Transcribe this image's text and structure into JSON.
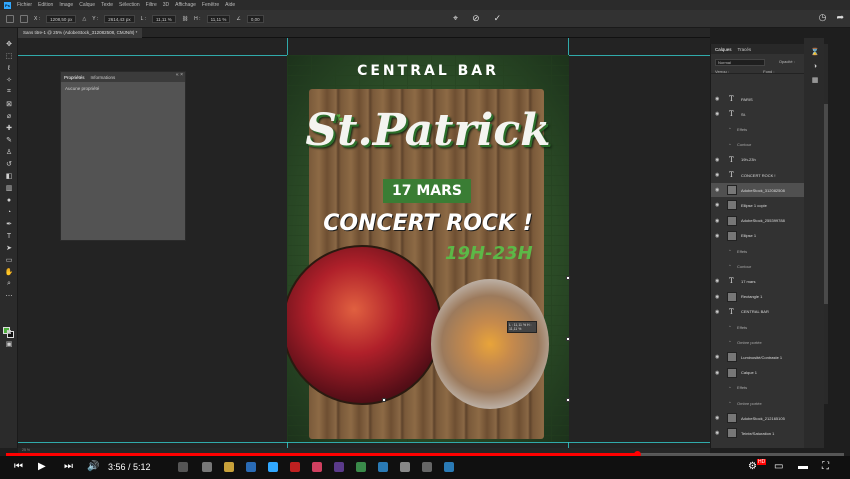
{
  "menu": [
    "Fichier",
    "Edition",
    "Image",
    "Calque",
    "Texte",
    "Sélection",
    "Filtre",
    "3D",
    "Affichage",
    "Fenêtre",
    "Aide"
  ],
  "app_logo": "Ps",
  "options": {
    "x_value": "1208,50 px",
    "y_value": "2614,43 px",
    "w_value": "11,11 %",
    "h_value": "11,11 %",
    "angle_value": "0,00"
  },
  "doc_tab": "Sans titre-1 @ 25% (AdobeStock_312082508, CMJN/8) *",
  "properties": {
    "tab_active": "Propriétés",
    "tab_other": "Informations",
    "body": "Aucune propriété"
  },
  "poster": {
    "header": "CENTRAL BAR",
    "title": "St.Patrick",
    "date": "17 MARS",
    "headline": "CONCERT ROCK !",
    "hours": "19H-23H"
  },
  "layers_panel": {
    "tab_active": "Calques",
    "tab_other": "Tracés",
    "blend_mode": "Normal",
    "opacity_label": "Opacité :",
    "opacity_value": "100 %",
    "fill_label": "Fond :",
    "fill_value": "100 %",
    "lock_label": "Verrou :"
  },
  "layers": [
    {
      "type": "text",
      "label": "PARIS",
      "fx": true
    },
    {
      "type": "text",
      "label": "St.",
      "fx": true
    },
    {
      "type": "sub",
      "label": "Effets"
    },
    {
      "type": "sub",
      "label": "Contour"
    },
    {
      "type": "text",
      "label": "19h-23h",
      "fx": true
    },
    {
      "type": "text",
      "label": "CONCERT ROCK !",
      "fx": false
    },
    {
      "type": "image",
      "label": "AdobeStock_312082508",
      "fx": false,
      "selected": true
    },
    {
      "type": "image",
      "label": "Ellipse 1 copie",
      "fx": false
    },
    {
      "type": "image",
      "label": "AdobeStock_255399788",
      "fx": false
    },
    {
      "type": "image",
      "label": "Ellipse 1",
      "fx": true
    },
    {
      "type": "sub",
      "label": "Effets"
    },
    {
      "type": "sub",
      "label": "Contour"
    },
    {
      "type": "text",
      "label": "17 mars",
      "fx": true
    },
    {
      "type": "image",
      "label": "Rectangle 1",
      "fx": false
    },
    {
      "type": "text",
      "label": "CENTRAL BAR",
      "fx": false
    },
    {
      "type": "sub",
      "label": "Effets"
    },
    {
      "type": "sub",
      "label": "Ombre portée"
    },
    {
      "type": "image",
      "label": "Luminosité/Contraste 1",
      "fx": false
    },
    {
      "type": "image",
      "label": "Calque 1",
      "fx": true
    },
    {
      "type": "sub",
      "label": "Effets"
    },
    {
      "type": "sub",
      "label": "Ombre portée"
    },
    {
      "type": "image",
      "label": "AdobeStock_212165105",
      "fx": false
    },
    {
      "type": "image",
      "label": "Teinte/Saturation 1",
      "fx": false
    }
  ],
  "status": "25 %",
  "video": {
    "time": "3:56 / 5:12",
    "hd_badge": "HD"
  },
  "tooltip": "L : 11,11 %\nH : 11,11 %"
}
